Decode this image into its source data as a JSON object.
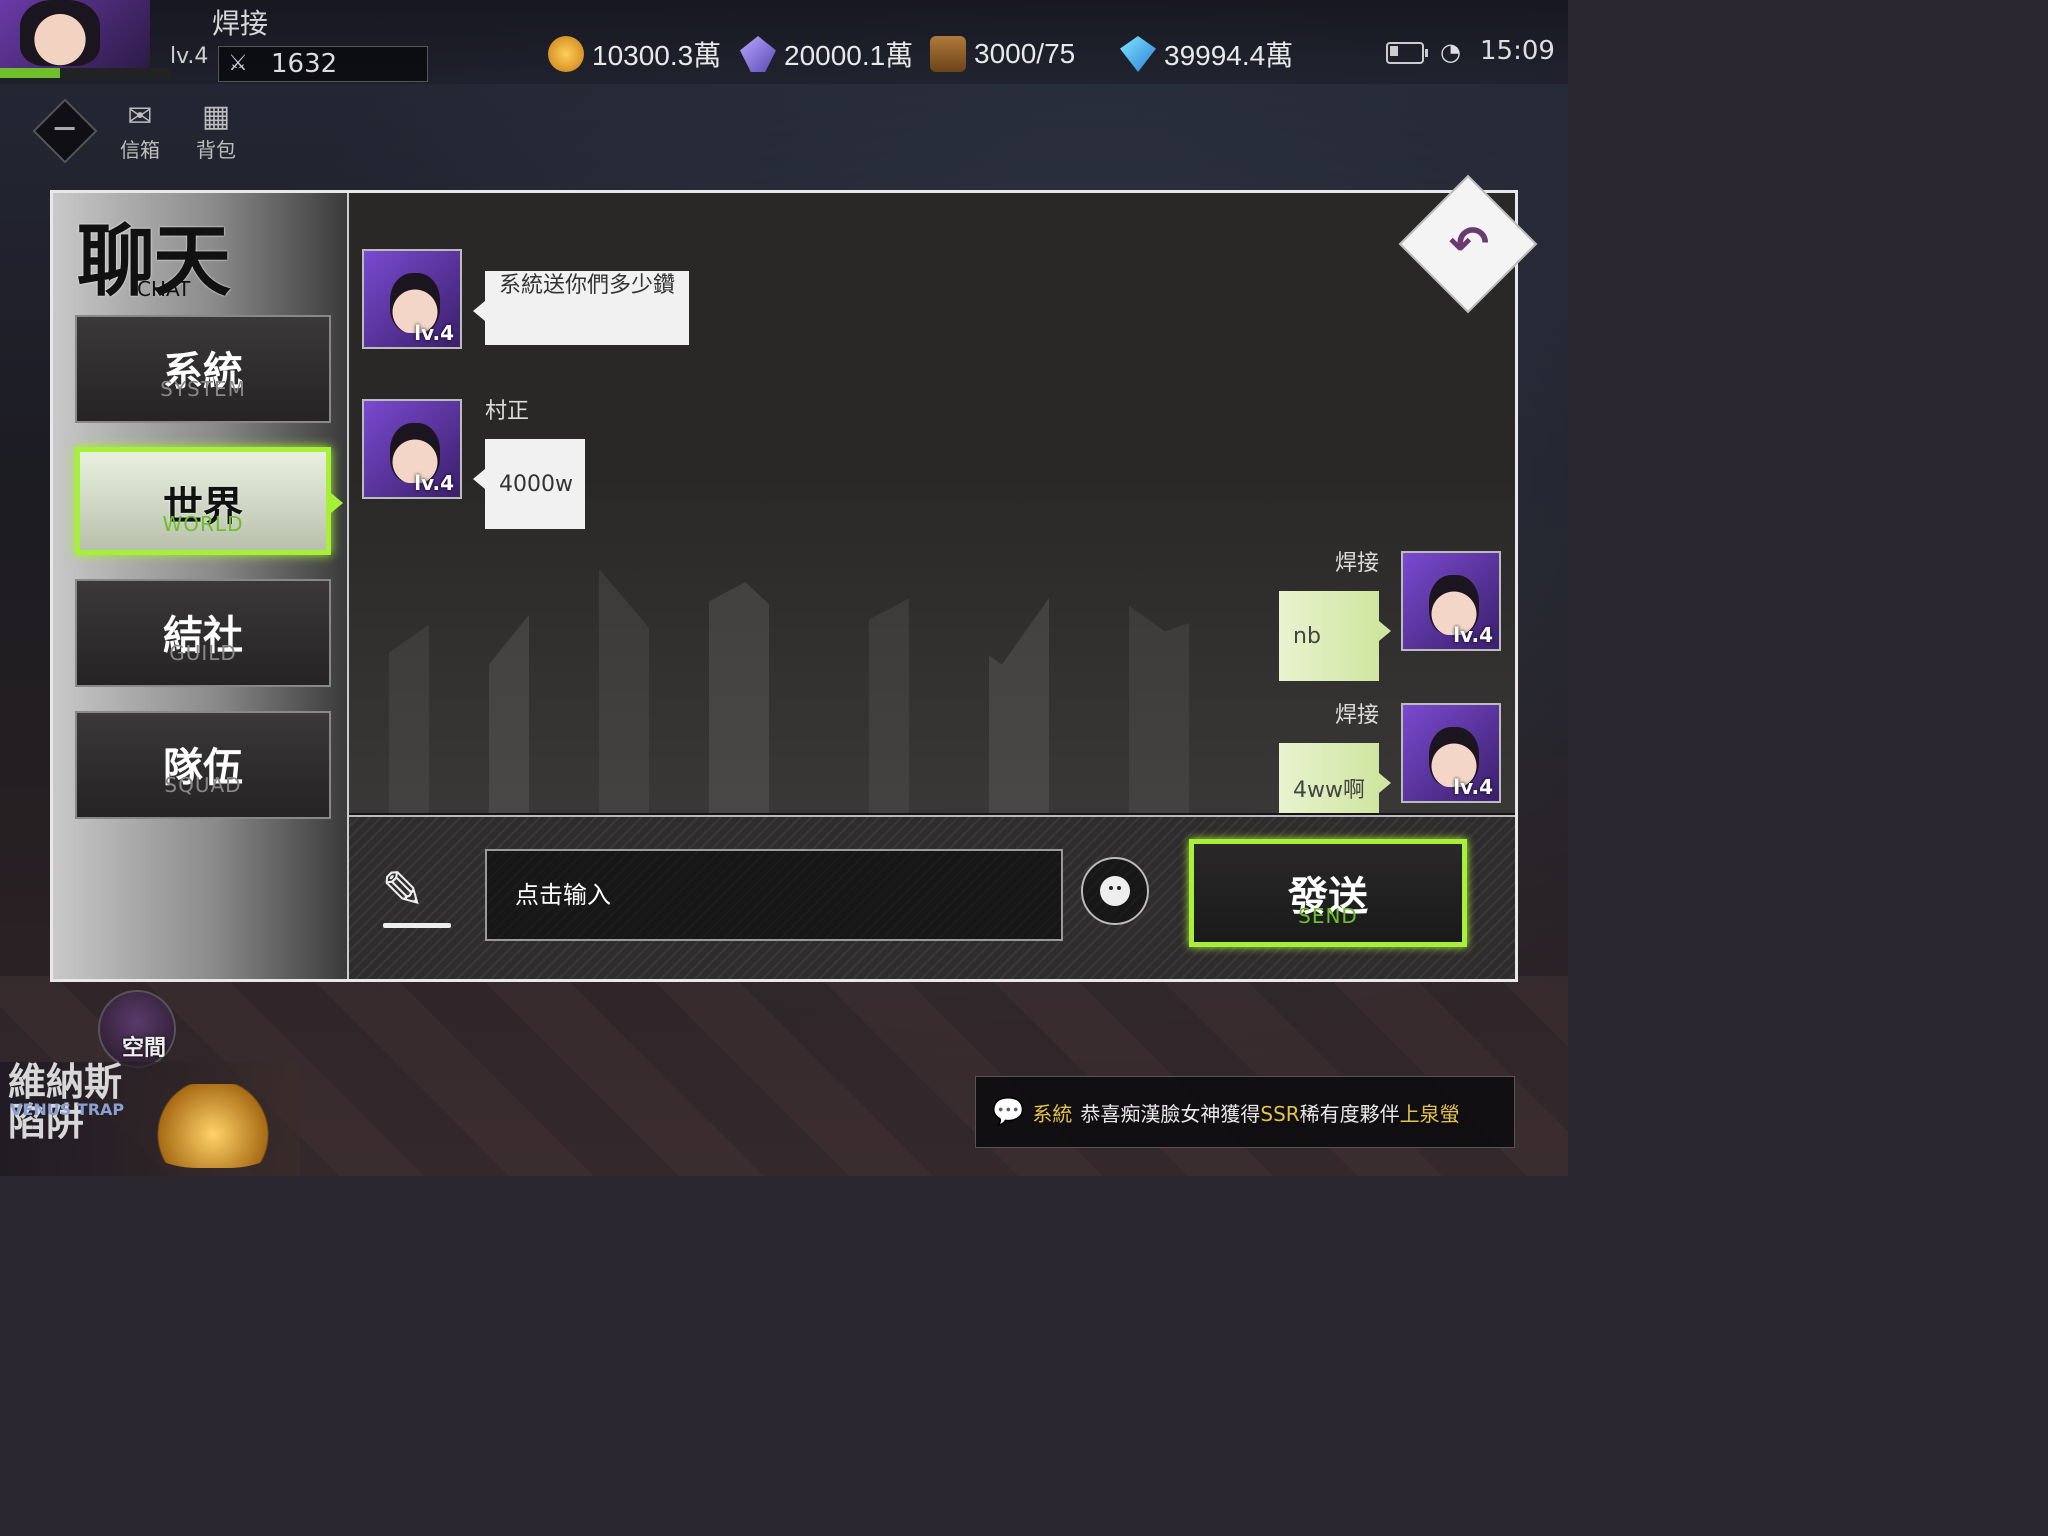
{
  "player": {
    "name": "焊接",
    "level": "lv.4",
    "power": "1632",
    "xp_fraction": 0.35
  },
  "resources": [
    {
      "icon": "gold-coin-icon",
      "value": "10300.3萬"
    },
    {
      "icon": "crystal-icon",
      "value": "20000.1萬"
    },
    {
      "icon": "chest-icon",
      "value": "3000/75"
    },
    {
      "icon": "diamond-icon",
      "value": "39994.4萬"
    }
  ],
  "status": {
    "time": "15:09"
  },
  "quick_menu": [
    {
      "icon": "mail-icon",
      "label": "信箱"
    },
    {
      "icon": "backpack-icon",
      "label": "背包"
    }
  ],
  "chat": {
    "title": "聊天",
    "subtitle": "CHAT",
    "tabs": [
      {
        "label": "系統",
        "sub": "SYSTEM"
      },
      {
        "label": "世界",
        "sub": "WORLD",
        "active": true
      },
      {
        "label": "結社",
        "sub": "GUILD"
      },
      {
        "label": "隊伍",
        "sub": "SQUAD"
      }
    ],
    "messages": [
      {
        "sender": "",
        "level": "lv.4",
        "text": "系統送你們多少鑽",
        "mine": false
      },
      {
        "sender": "村正",
        "level": "lv.4",
        "text": "4000w",
        "mine": false
      },
      {
        "sender": "焊接",
        "level": "lv.4",
        "text": "nb",
        "mine": true
      },
      {
        "sender": "焊接",
        "level": "lv.4",
        "text": "4ww啊",
        "mine": true
      }
    ],
    "input_placeholder": "点击输入",
    "send_label": "發送",
    "send_sub": "SEND"
  },
  "space_label": "空間",
  "event": {
    "title": "維納斯陷阱",
    "sub": "VENUS TRAP"
  },
  "ticker": {
    "tag": "系統",
    "text": "恭喜痴漢臉女神獲得",
    "rarity": "SSR",
    "text2": "稀有度夥伴",
    "partner": "上泉螢"
  },
  "colors": {
    "accent": "#a6f03a",
    "gold": "#e3c44a"
  }
}
